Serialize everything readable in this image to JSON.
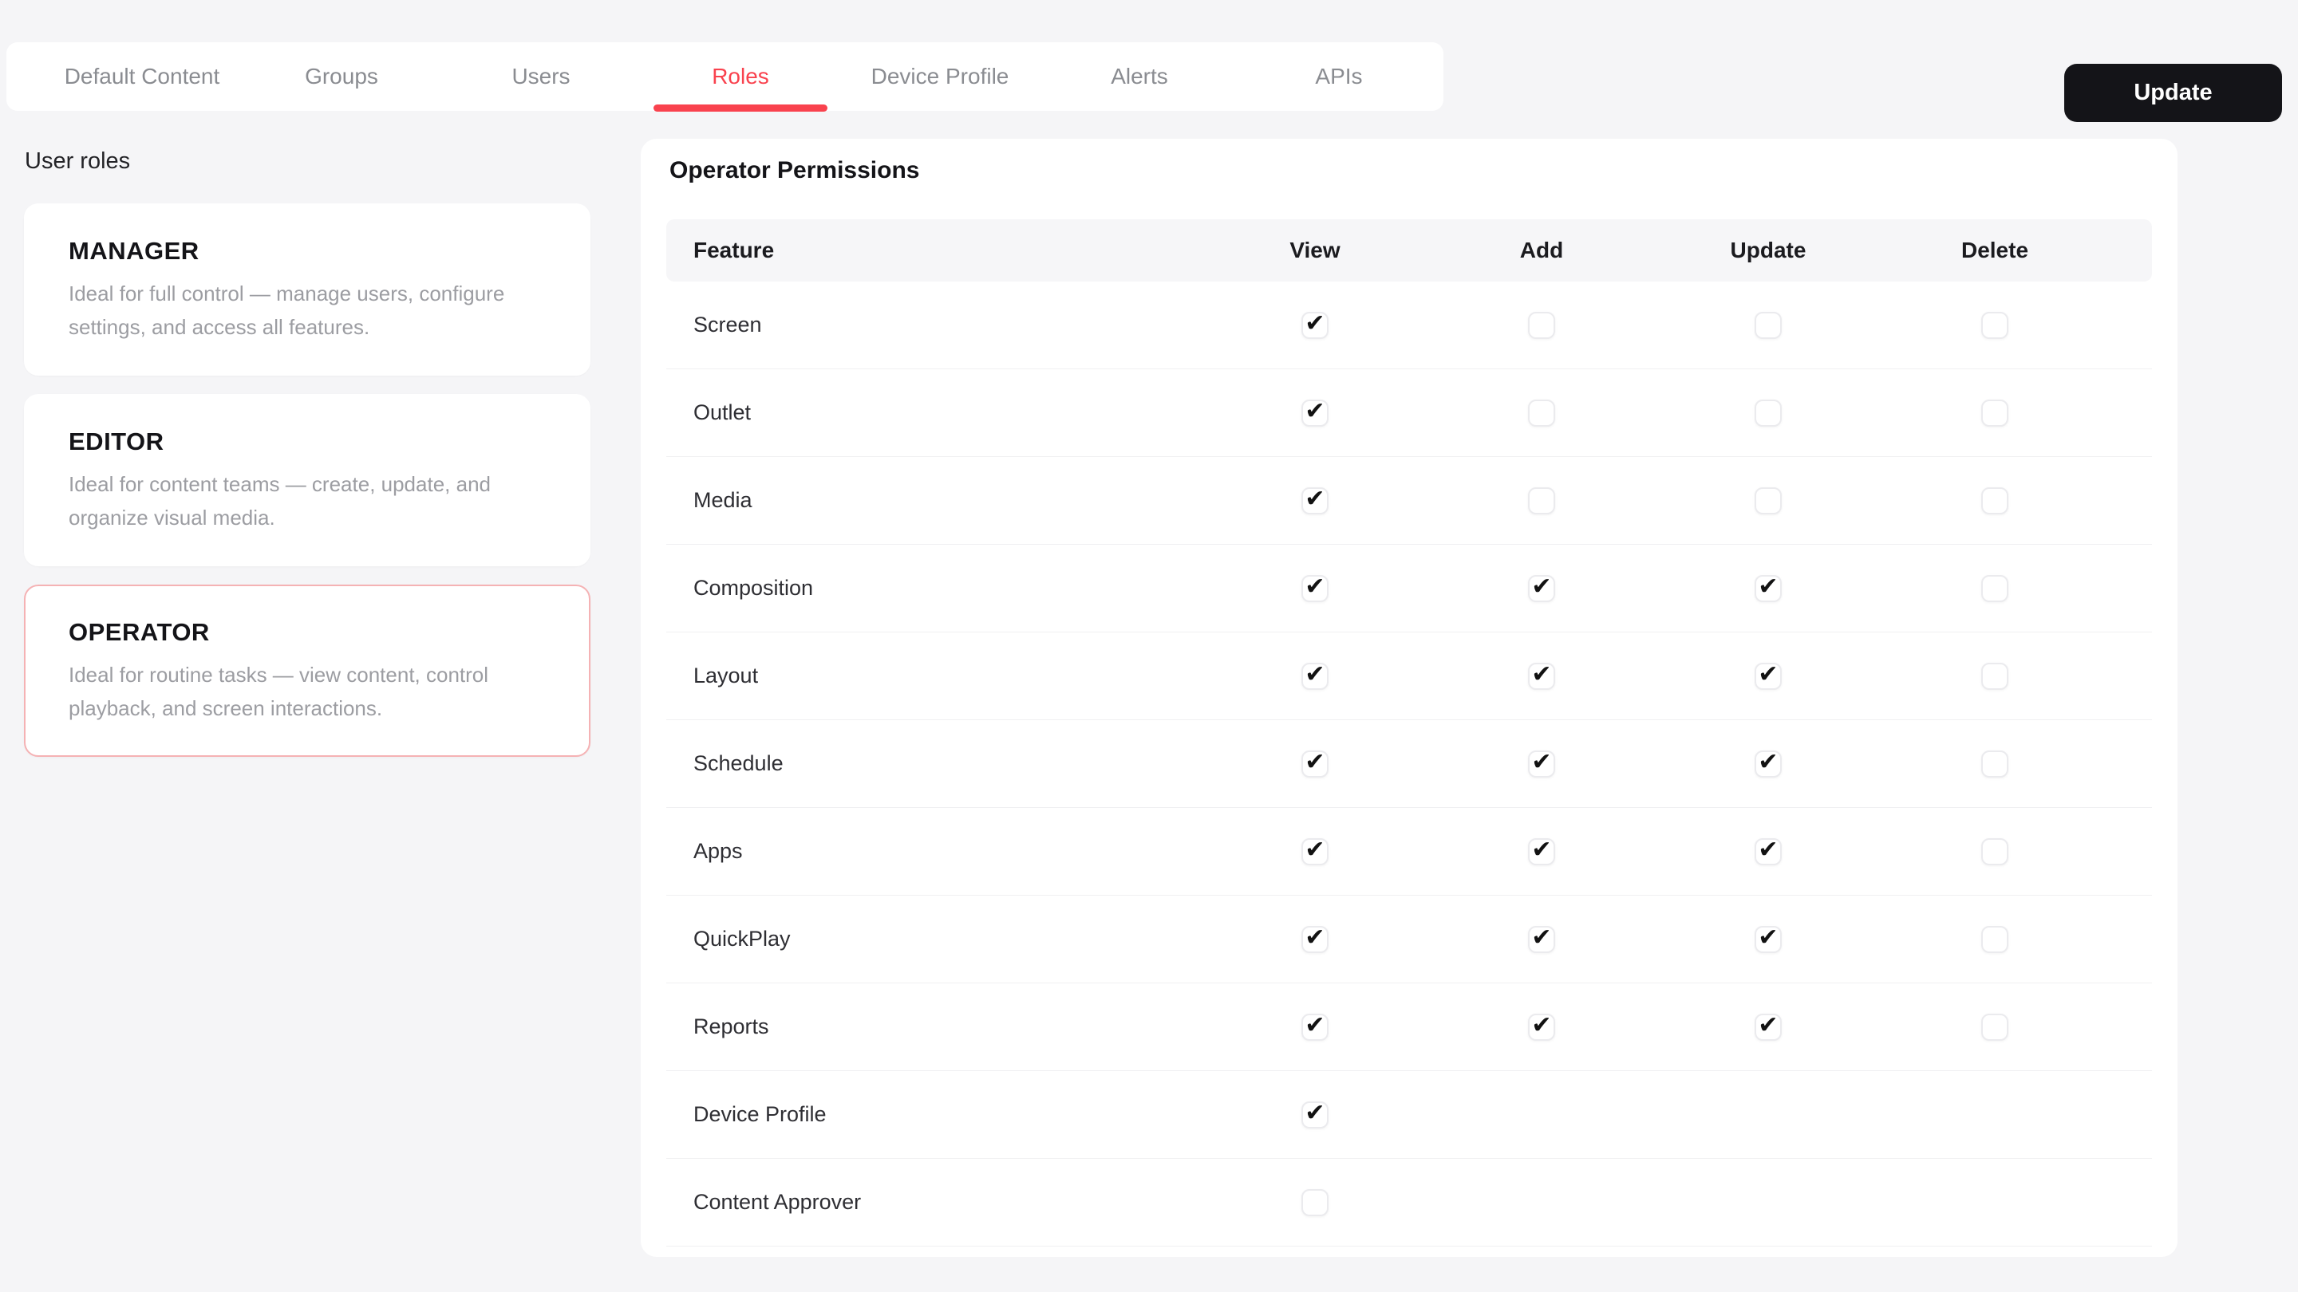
{
  "header": {
    "tabs": [
      {
        "label": "Default Content",
        "active": false
      },
      {
        "label": "Groups",
        "active": false
      },
      {
        "label": "Users",
        "active": false
      },
      {
        "label": "Roles",
        "active": true
      },
      {
        "label": "Device Profile",
        "active": false
      },
      {
        "label": "Alerts",
        "active": false
      },
      {
        "label": "APIs",
        "active": false
      }
    ],
    "update_button_label": "Update"
  },
  "roles_panel": {
    "heading": "User roles",
    "roles": [
      {
        "name": "MANAGER",
        "description": "Ideal for full control — manage users, configure settings, and access all features.",
        "selected": false
      },
      {
        "name": "EDITOR",
        "description": "Ideal for content teams — create, update, and organize visual media.",
        "selected": false
      },
      {
        "name": "OPERATOR",
        "description": "Ideal for routine tasks — view content, control playback, and screen interactions.",
        "selected": true
      }
    ]
  },
  "permissions_panel": {
    "title": "Operator Permissions",
    "columns": [
      "Feature",
      "View",
      "Add",
      "Update",
      "Delete"
    ],
    "rows": [
      {
        "feature": "Screen",
        "view": "checked",
        "add": "unchecked",
        "update": "unchecked",
        "delete": "unchecked"
      },
      {
        "feature": "Outlet",
        "view": "checked",
        "add": "unchecked",
        "update": "unchecked",
        "delete": "unchecked"
      },
      {
        "feature": "Media",
        "view": "checked",
        "add": "unchecked",
        "update": "unchecked",
        "delete": "unchecked"
      },
      {
        "feature": "Composition",
        "view": "checked",
        "add": "checked",
        "update": "checked",
        "delete": "unchecked"
      },
      {
        "feature": "Layout",
        "view": "checked",
        "add": "checked",
        "update": "checked",
        "delete": "unchecked"
      },
      {
        "feature": "Schedule",
        "view": "checked",
        "add": "checked",
        "update": "checked",
        "delete": "unchecked"
      },
      {
        "feature": "Apps",
        "view": "checked",
        "add": "checked",
        "update": "checked",
        "delete": "unchecked"
      },
      {
        "feature": "QuickPlay",
        "view": "checked",
        "add": "checked",
        "update": "checked",
        "delete": "unchecked"
      },
      {
        "feature": "Reports",
        "view": "checked",
        "add": "checked",
        "update": "checked",
        "delete": "unchecked"
      },
      {
        "feature": "Device Profile",
        "view": "checked",
        "add": "none",
        "update": "none",
        "delete": "none"
      },
      {
        "feature": "Content Approver",
        "view": "unchecked",
        "add": "none",
        "update": "none",
        "delete": "none"
      }
    ]
  },
  "colors": {
    "accent_red": "#f9424e",
    "button_black": "#141418",
    "check_mark": "#121212"
  },
  "icons": {
    "check_glyph": "✔"
  }
}
